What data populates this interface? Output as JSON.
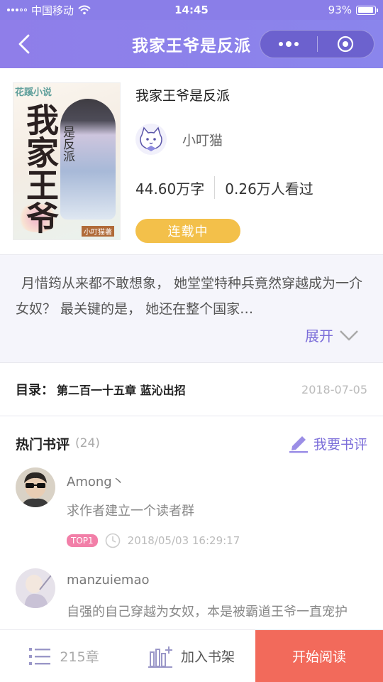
{
  "status_bar": {
    "carrier": "中国移动",
    "time": "14:45",
    "battery": "93%"
  },
  "nav": {
    "title": "我家王爷是反派"
  },
  "book": {
    "cover": {
      "brand": "花蹊小说",
      "title": "我家王爷",
      "subtitle": "是反派",
      "author": "小叮猫著"
    },
    "title": "我家王爷是反派",
    "author": "小叮猫",
    "word_count": "44.60万字",
    "views": "0.26万人看过",
    "status": "连载中"
  },
  "summary": {
    "text": "月惜筠从来都不敢想象， 她堂堂特种兵竟然穿越成为一介女奴？ 最关键的是， 她还在整个国家…",
    "expand_label": "展开"
  },
  "toc": {
    "label": "目录：",
    "latest_chapter": "第二百一十五章 蓝沁出招",
    "date": "2018-07-05"
  },
  "reviews": {
    "title": "热门书评",
    "count": "(24)",
    "write_label": "我要书评",
    "items": [
      {
        "name": "Among丶",
        "text": "求作者建立一个读者群",
        "badge": "TOP1",
        "time": "2018/05/03 16:29:17"
      },
      {
        "name": "manzuiemao",
        "text": "自强的自己穿越为女奴，本是被霸道王爷一直宠护"
      }
    ]
  },
  "bottom_bar": {
    "chapters": "215章",
    "add_shelf": "加入书架",
    "start_reading": "开始阅读"
  }
}
